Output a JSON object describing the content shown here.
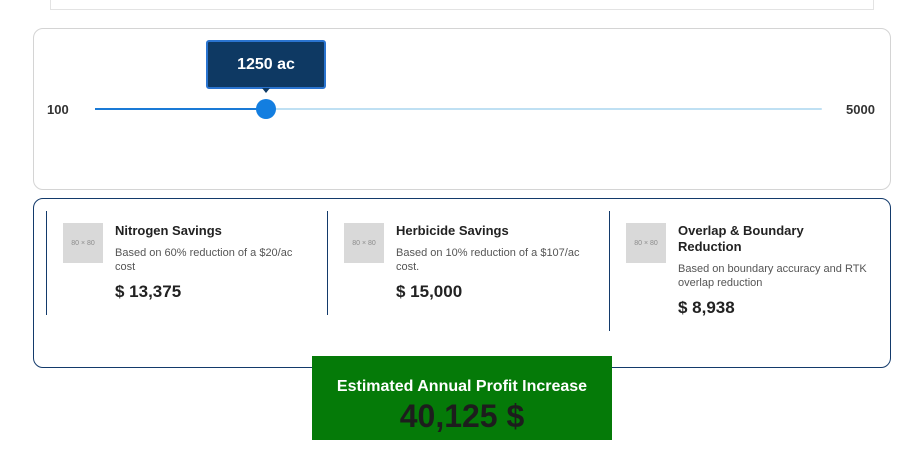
{
  "slider": {
    "min_label": "100",
    "max_label": "5000",
    "min": 100,
    "max": 5000,
    "value": 1250,
    "tooltip": "1250 ac"
  },
  "savings": [
    {
      "title": "Nitrogen Savings",
      "description": "Based on 60% reduction of a $20/ac cost",
      "amount": "$ 13,375",
      "image_placeholder": "80 × 80"
    },
    {
      "title": "Herbicide Savings",
      "description": "Based on 10% reduction of a $107/ac cost.",
      "amount": "$ 15,000",
      "image_placeholder": "80 × 80"
    },
    {
      "title": "Overlap & Boundary Reduction",
      "description": "Based on boundary accuracy and RTK overlap reduction",
      "amount": "$ 8,938",
      "image_placeholder": "80 × 80"
    }
  ],
  "profit": {
    "label": "Estimated Annual Profit Increase",
    "value": "40,125 $"
  },
  "colors": {
    "accent": "#137ee0",
    "tooltip_bg": "#0e3963",
    "card_border": "#133a6b",
    "profit_bg": "#057a08"
  }
}
